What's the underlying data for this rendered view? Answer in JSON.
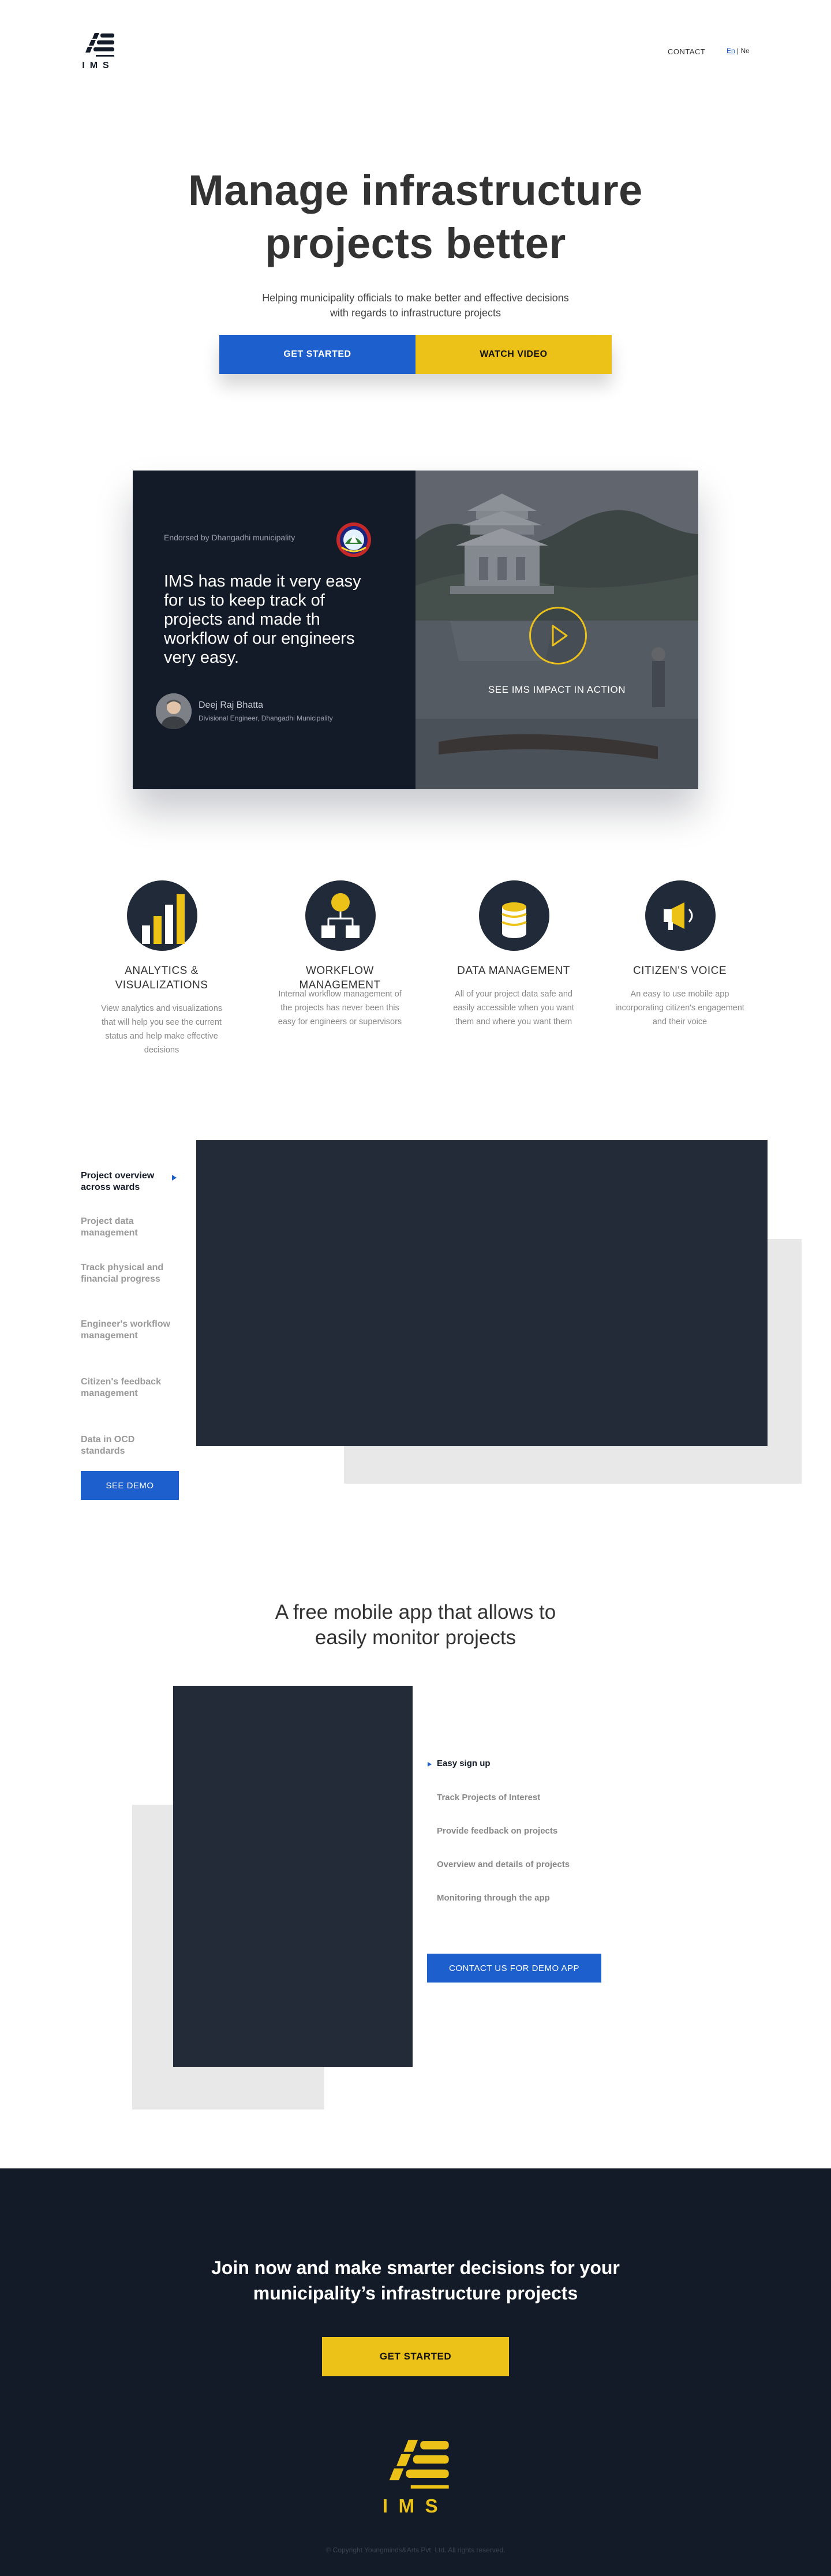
{
  "nav": {
    "logo_text": "IMS",
    "contact": "CONTACT",
    "lang_en": "En",
    "lang_sep": "|",
    "lang_ne": "Ne"
  },
  "hero": {
    "title_line1": "Manage infrastructure",
    "title_line2": "projects better",
    "subtitle_line1": "Helping municipality officials to make better and effective decisions",
    "subtitle_line2": "with regards to infrastructure projects",
    "cta_primary": "GET STARTED",
    "cta_secondary": "WATCH VIDEO"
  },
  "testimonial": {
    "endorsed": "Endorsed by Dhangadhi municipality",
    "quote": "IMS has made it very easy for us to keep track of projects and made th workflow of our engineers very easy.",
    "person_name": "Deej Raj Bhatta",
    "person_role": "Divisional Engineer, Dhangadhi Municipality",
    "video_label": "SEE IMS IMPACT IN ACTION"
  },
  "features": [
    {
      "icon": "bar-chart-icon",
      "title": "ANALYTICS & VISUALIZATIONS",
      "desc": "View analytics and visualizations that will help you see the current status and help make effective decisions"
    },
    {
      "icon": "workflow-icon",
      "title": "WORKFLOW MANAGEMENT",
      "desc": "Internal workflow management of the projects has never been this easy for engineers or supervisors"
    },
    {
      "icon": "database-icon",
      "title": "DATA MANAGEMENT",
      "desc": "All of your project data safe and easily accessible when you want them and where you want them"
    },
    {
      "icon": "megaphone-icon",
      "title": "CITIZEN'S VOICE",
      "desc": "An easy to use mobile app incorporating citizen's engagement and their voice"
    }
  ],
  "overview": {
    "items": [
      "Project overview across wards",
      "Project data management",
      "Track physical and financial progress",
      "Engineer's workflow management",
      "Citizen's feedback management",
      "Data in OCD standards"
    ],
    "active_index": 0,
    "cta": "SEE DEMO"
  },
  "mobile_app": {
    "title_line1": "A free mobile app that allows to",
    "title_line2": "easily monitor projects",
    "items": [
      "Easy sign up",
      "Track Projects of Interest",
      "Provide feedback on projects",
      "Overview and details of projects",
      "Monitoring through the app"
    ],
    "active_index": 0,
    "cta": "CONTACT US FOR DEMO APP"
  },
  "footer": {
    "join_line1": "Join now and make smarter decisions for your",
    "join_line2": "municipality’s infrastructure projects",
    "cta": "GET STARTED",
    "logo_text": "IMS",
    "copyright": "© Copyright Youngminds&Arts Pvt. Ltd. All rights reserved."
  },
  "colors": {
    "primary_blue": "#1d5fcc",
    "accent_yellow": "#edc218",
    "dark_navy": "#141b28",
    "panel_dark": "#242b38"
  }
}
